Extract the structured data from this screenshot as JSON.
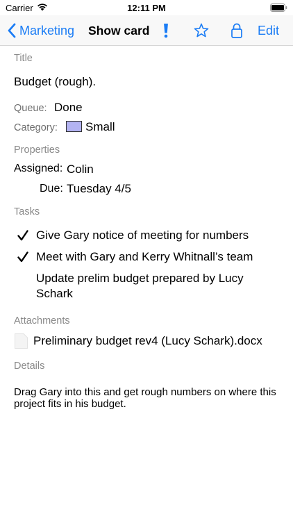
{
  "status_bar": {
    "carrier": "Carrier",
    "time": "12:11 PM"
  },
  "nav": {
    "back_label": "Marketing",
    "title": "Show card",
    "edit_label": "Edit"
  },
  "card": {
    "title_label": "Title",
    "title_value": "Budget (rough).",
    "queue_label": "Queue:",
    "queue_value": "Done",
    "category_label": "Category:",
    "category_value": "Small",
    "category_color": "#b3b3f2",
    "properties_label": "Properties",
    "assigned_label": "Assigned:",
    "assigned_value": "Colin",
    "due_label": "Due:",
    "due_value": "Tuesday 4/5",
    "tasks_label": "Tasks",
    "tasks": [
      {
        "text": "Give Gary notice of meeting for numbers",
        "done": true
      },
      {
        "text": "Meet with Gary and Kerry Whitnall’s team",
        "done": true
      },
      {
        "text": "Update prelim budget prepared by Lucy Schark",
        "done": false
      }
    ],
    "attachments_label": "Attachments",
    "attachments": [
      {
        "name": "Preliminary budget rev4 (Lucy Schark).docx"
      }
    ],
    "details_label": "Details",
    "details_text": "Drag Gary into this and get rough numbers on where this project fits in his budget."
  },
  "colors": {
    "accent": "#1a7cf5",
    "section_label": "#8a8a8a"
  },
  "icons": {
    "back": "chevron-left-icon",
    "priority": "exclamation-icon",
    "star": "star-icon",
    "lock": "lock-icon",
    "check": "checkmark-icon",
    "attachment": "document-icon"
  }
}
